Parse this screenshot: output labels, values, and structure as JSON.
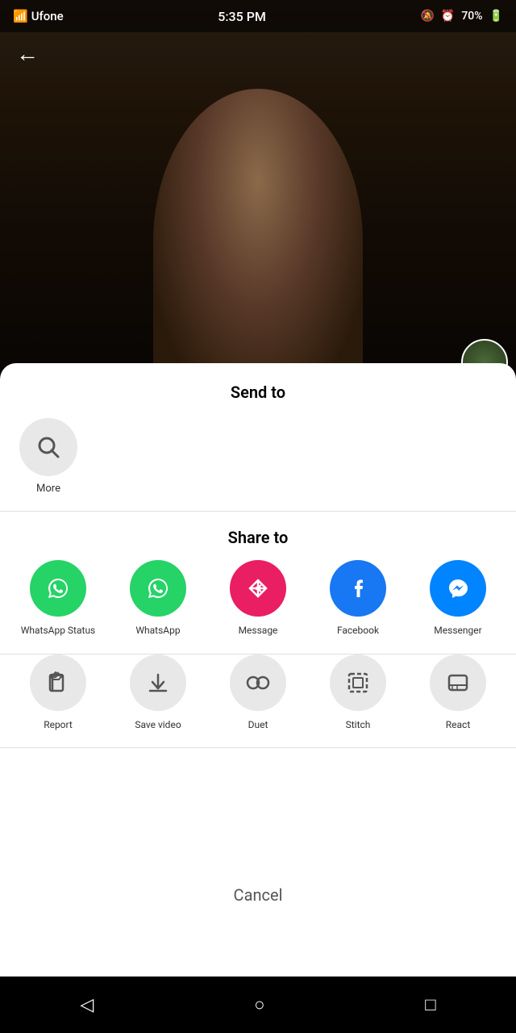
{
  "statusBar": {
    "carrier": "Ufone",
    "time": "5:35 PM",
    "battery": "70%"
  },
  "header": {
    "back_label": "←"
  },
  "bottomSheet": {
    "sendToTitle": "Send to",
    "shareToTitle": "Share to",
    "cancelLabel": "Cancel"
  },
  "recentRow": {
    "items": [
      {
        "label": "More",
        "icon": "search"
      }
    ]
  },
  "shareRow1": [
    {
      "id": "whatsapp-status",
      "label": "WhatsApp Status",
      "type": "whatsapp"
    },
    {
      "id": "whatsapp",
      "label": "WhatsApp",
      "type": "whatsapp"
    },
    {
      "id": "message",
      "label": "Message",
      "type": "message"
    },
    {
      "id": "facebook",
      "label": "Facebook",
      "type": "facebook"
    },
    {
      "id": "messenger",
      "label": "Messenger",
      "type": "messenger"
    }
  ],
  "shareRow2": [
    {
      "id": "report",
      "label": "Report",
      "icon": "flag"
    },
    {
      "id": "save-video",
      "label": "Save video",
      "icon": "download"
    },
    {
      "id": "duet",
      "label": "Duet",
      "icon": "duet"
    },
    {
      "id": "stitch",
      "label": "Stitch",
      "icon": "stitch"
    },
    {
      "id": "react",
      "label": "React",
      "icon": "react"
    }
  ],
  "navBar": {
    "back": "◁",
    "home": "○",
    "recent": "□"
  }
}
